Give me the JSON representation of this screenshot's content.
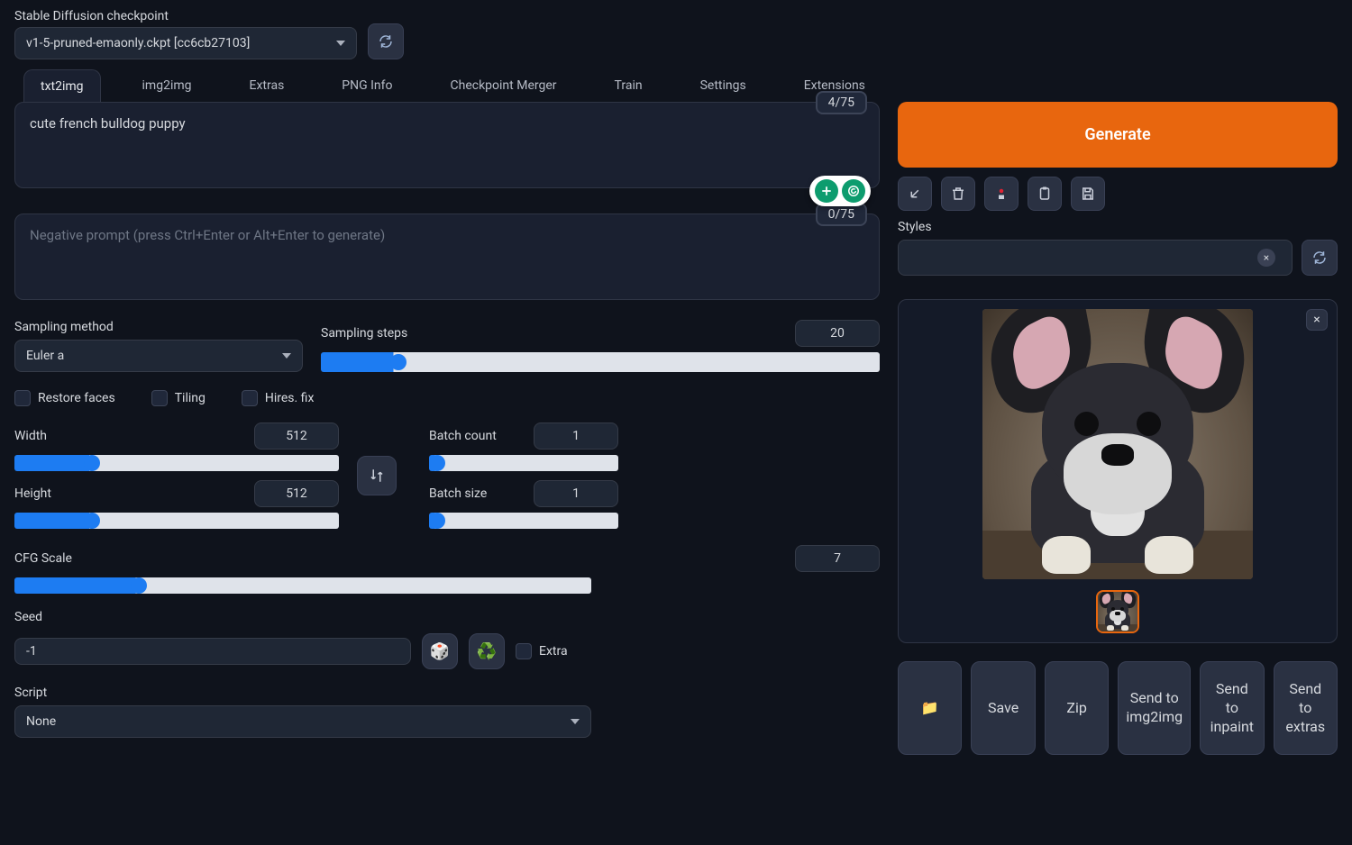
{
  "header": {
    "checkpoint_label": "Stable Diffusion checkpoint",
    "checkpoint_value": "v1-5-pruned-emaonly.ckpt [cc6cb27103]"
  },
  "tabs": [
    "txt2img",
    "img2img",
    "Extras",
    "PNG Info",
    "Checkpoint Merger",
    "Train",
    "Settings",
    "Extensions"
  ],
  "active_tab": "txt2img",
  "prompt": {
    "value": "cute french bulldog puppy",
    "token_count": "4/75"
  },
  "neg_prompt": {
    "placeholder": "Negative prompt (press Ctrl+Enter or Alt+Enter to generate)",
    "token_count": "0/75"
  },
  "sampling": {
    "method_label": "Sampling method",
    "method_value": "Euler a",
    "steps_label": "Sampling steps",
    "steps_value": "20",
    "steps_min": 1,
    "steps_max": 150
  },
  "checks": {
    "restore_faces": "Restore faces",
    "tiling": "Tiling",
    "hires_fix": "Hires. fix"
  },
  "dims": {
    "width_label": "Width",
    "width_value": "512",
    "height_label": "Height",
    "height_value": "512",
    "dim_min": 64,
    "dim_max": 2048,
    "batch_count_label": "Batch count",
    "batch_count_value": "1",
    "batch_size_label": "Batch size",
    "batch_size_value": "1",
    "batch_min": 1,
    "batch_max": 16
  },
  "cfg": {
    "label": "CFG Scale",
    "value": "7",
    "min": 1,
    "max": 30
  },
  "seed": {
    "label": "Seed",
    "value": "-1",
    "extra_label": "Extra"
  },
  "script": {
    "label": "Script",
    "value": "None"
  },
  "right": {
    "generate_label": "Generate",
    "styles_label": "Styles",
    "buttons": {
      "save": "Save",
      "zip": "Zip",
      "send_img2img": "Send to img2img",
      "send_inpaint": "Send to inpaint",
      "send_extras": "Send to extras"
    }
  },
  "icons": {
    "refresh": "refresh-icon",
    "arrow_in": "arrow-down-left-icon",
    "trash": "trash-icon",
    "stop": "stop-record-icon",
    "clipboard": "clipboard-icon",
    "floppy": "save-floppy-icon",
    "swap": "swap-icon",
    "dice": "🎲",
    "recycle": "♻️",
    "folder": "📁"
  }
}
